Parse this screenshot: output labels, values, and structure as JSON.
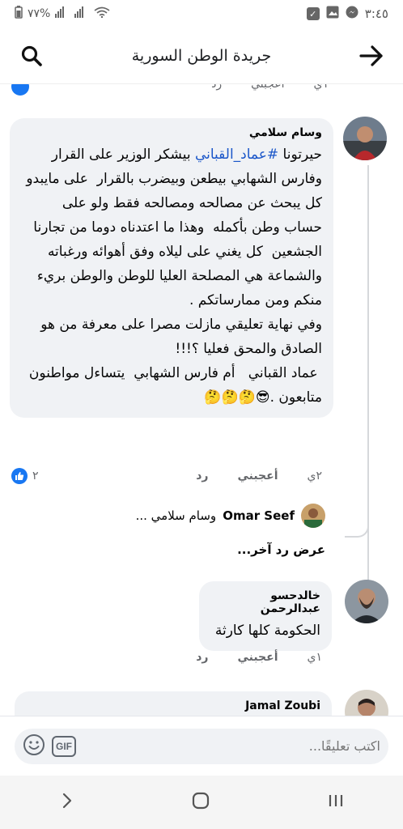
{
  "status_bar": {
    "time": "٣:٤٥",
    "battery": "٧٧%"
  },
  "header": {
    "title": "جريدة الوطن السورية"
  },
  "partial_previous": {
    "time": "١ي",
    "like_label": "أعجبني",
    "reply_label": "رد"
  },
  "comments": [
    {
      "author": "وسام سلامي",
      "text_before_mention": "حيرتونا ",
      "mention": "#عماد_القباني",
      "text_after_mention": " بيشكر الوزير على القرار وفارس الشهابي بيطعن وبيضرب بالقرار  على مايبدو كل يبحث عن مصالحه ومصالحه فقط ولو على حساب وطن بأكمله  وهذا ما اعتدناه دوما من تجارنا الجشعين  كل يغني على ليلاه وفق أهوائه ورغباته والشماعة هي المصلحة العليا للوطن والوطن بريء منكم ومن ممارساتكم .\nوفي نهاية تعليقي مازلت مصرا على معرفة من هو الصادق والمحق فعليا ؟!!!\n عماد القباني   أم فارس الشهابي  يتساءل مواطنون متابعون .😎🤔🤔🤔",
      "time": "٢ي",
      "like_label": "أعجبني",
      "reply_label": "رد",
      "reactions": "٢"
    },
    {
      "author": "خالدحسو عبدالرحمن",
      "text": "الحكومة كلها كارثة",
      "time": "١ي",
      "like_label": "أعجبني",
      "reply_label": "رد"
    },
    {
      "author": "Jamal Zoubi"
    }
  ],
  "reply_preview": {
    "name": "Omar Seef",
    "text": "وسام سلامي ..."
  },
  "more_replies": "عرض رد آخر...",
  "composer": {
    "placeholder": "اكتب تعليقًا...",
    "gif_label": "GIF"
  },
  "colors": {
    "accent": "#1877f2",
    "bubble": "#f0f2f5",
    "mention": "#1a56c9"
  }
}
